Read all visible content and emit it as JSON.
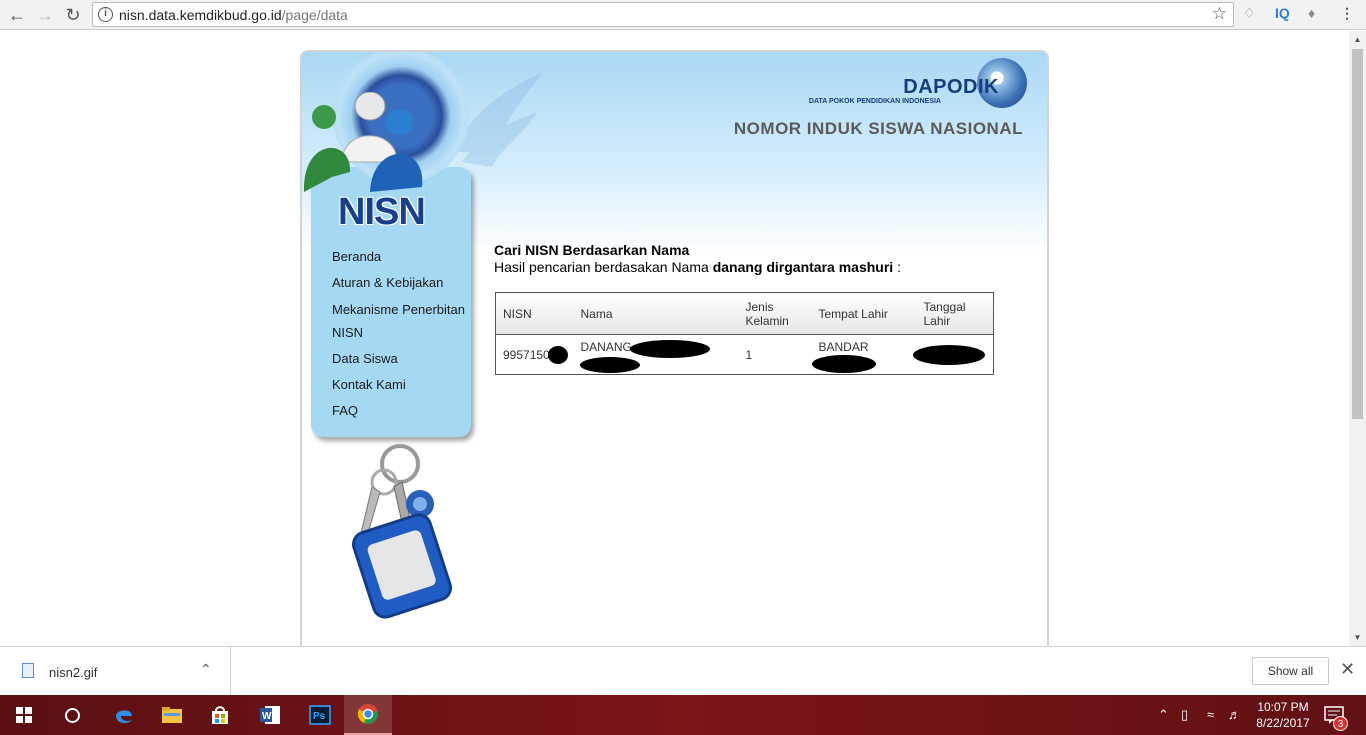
{
  "browser": {
    "url_host": "nisn.data.kemdikbud.go.id",
    "url_path": "/page/data",
    "ext_iq": "IQ"
  },
  "site": {
    "dapodik_logo": "DAPODIK",
    "dapodik_sub": "DATA POKOK PENDIDIKAN INDONESIA",
    "header_title": "NOMOR INDUK SISWA NASIONAL",
    "nisn_logo": "NISN",
    "menu": [
      {
        "label": "Beranda"
      },
      {
        "label": "Aturan & Kebijakan"
      },
      {
        "label": "Mekanisme Penerbitan NISN"
      },
      {
        "label": "Data Siswa"
      },
      {
        "label": "Kontak Kami"
      },
      {
        "label": "FAQ"
      }
    ],
    "search": {
      "title": "Cari NISN Berdasarkan Nama",
      "subtitle_prefix": "Hasil pencarian berdasakan Nama",
      "query": "danang dirgantara mashuri",
      "suffix": ":"
    },
    "table": {
      "headers": [
        "NISN",
        "Nama",
        "Jenis Kelamin",
        "Tempat Lahir",
        "Tanggal Lahir"
      ],
      "row": {
        "nisn": "9957150",
        "nama": "DANANG",
        "jenis_kelamin": "1",
        "tempat_lahir": "BANDAR",
        "tanggal_lahir": ""
      }
    }
  },
  "downloads": {
    "file": "nisn2.gif",
    "show_all": "Show all"
  },
  "taskbar": {
    "time": "10:07 PM",
    "date": "8/22/2017",
    "notifications": "3"
  }
}
